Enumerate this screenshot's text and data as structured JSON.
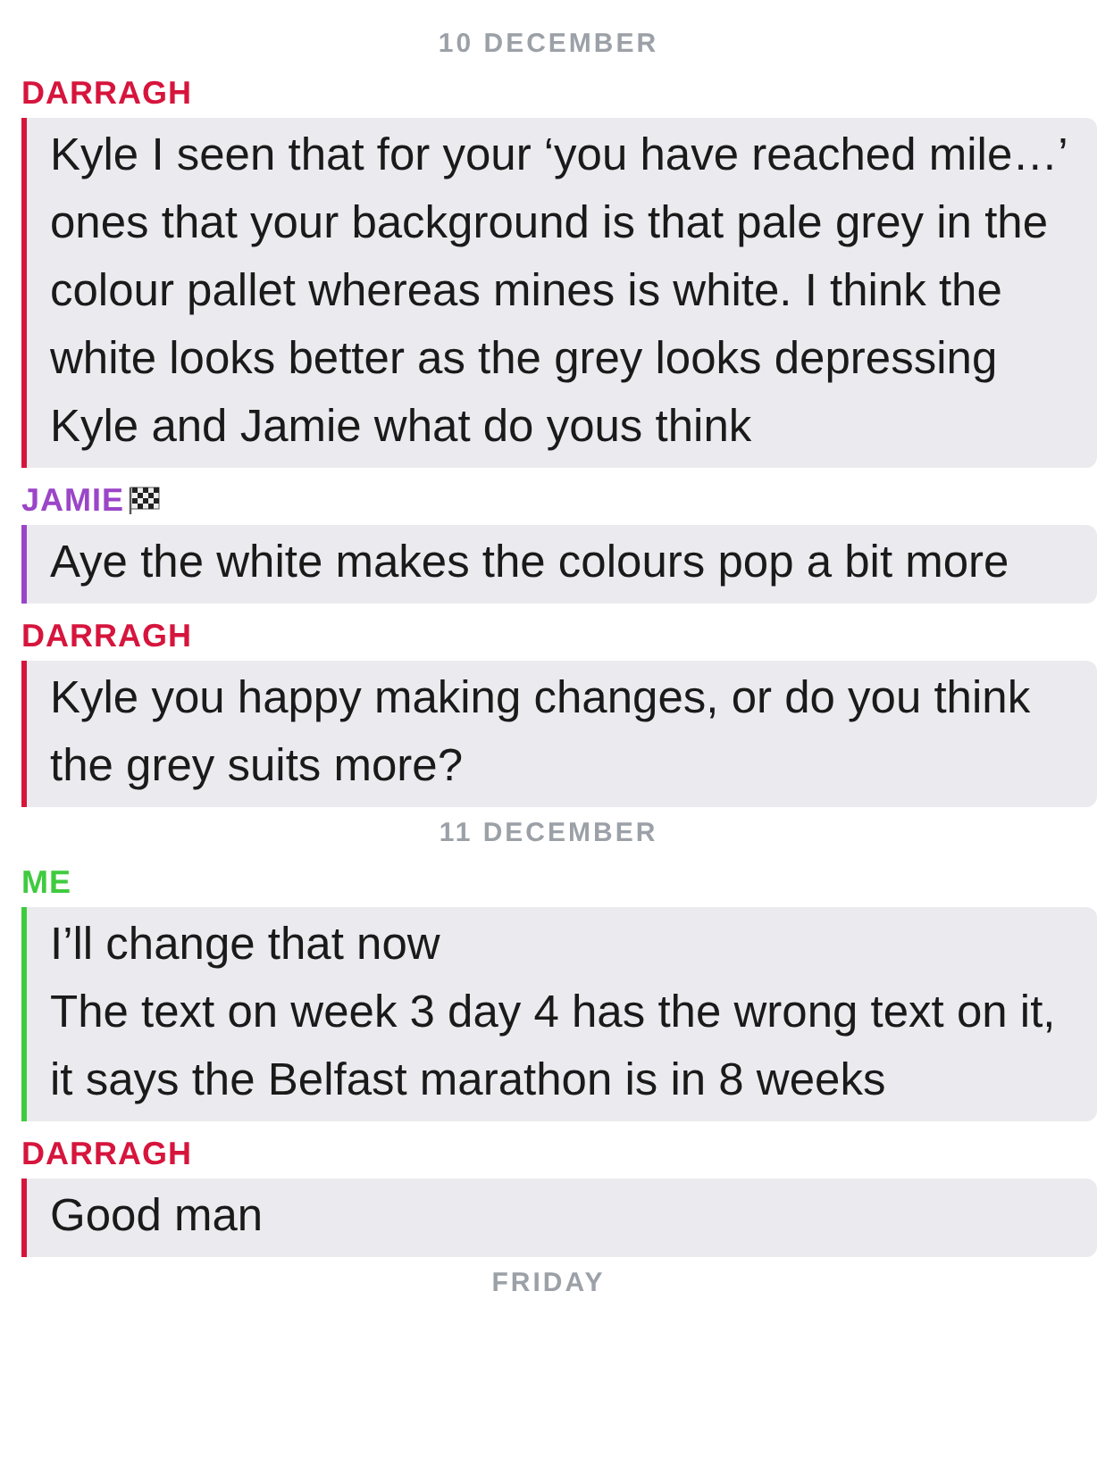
{
  "items": [
    {
      "kind": "date",
      "label": "10 DECEMBER"
    },
    {
      "kind": "message",
      "sender": "DARRAGH",
      "color": "#d6153d",
      "flag": false,
      "paragraphs": [
        "Kyle I seen that for your ‘you have reached mile…’ ones that your background is that pale grey in the colour pallet whereas mines is white. I think the white looks better as the grey looks depressing",
        "Kyle and Jamie what do yous think"
      ]
    },
    {
      "kind": "message",
      "sender": "JAMIE",
      "color": "#9b45c8",
      "flag": true,
      "paragraphs": [
        "Aye the white makes the colours pop a bit more"
      ]
    },
    {
      "kind": "message",
      "sender": "DARRAGH",
      "color": "#d6153d",
      "flag": false,
      "paragraphs": [
        "Kyle you happy making changes, or do you think the grey suits more?"
      ]
    },
    {
      "kind": "date",
      "label": "11 DECEMBER"
    },
    {
      "kind": "message",
      "sender": "ME",
      "color": "#3fcb3f",
      "flag": false,
      "paragraphs": [
        "I’ll change that now",
        "The text on week 3 day 4 has the wrong text on it, it says the Belfast marathon is in 8 weeks"
      ]
    },
    {
      "kind": "message",
      "sender": "DARRAGH",
      "color": "#d6153d",
      "flag": false,
      "paragraphs": [
        "Good man"
      ]
    },
    {
      "kind": "date",
      "label": "FRIDAY"
    }
  ]
}
